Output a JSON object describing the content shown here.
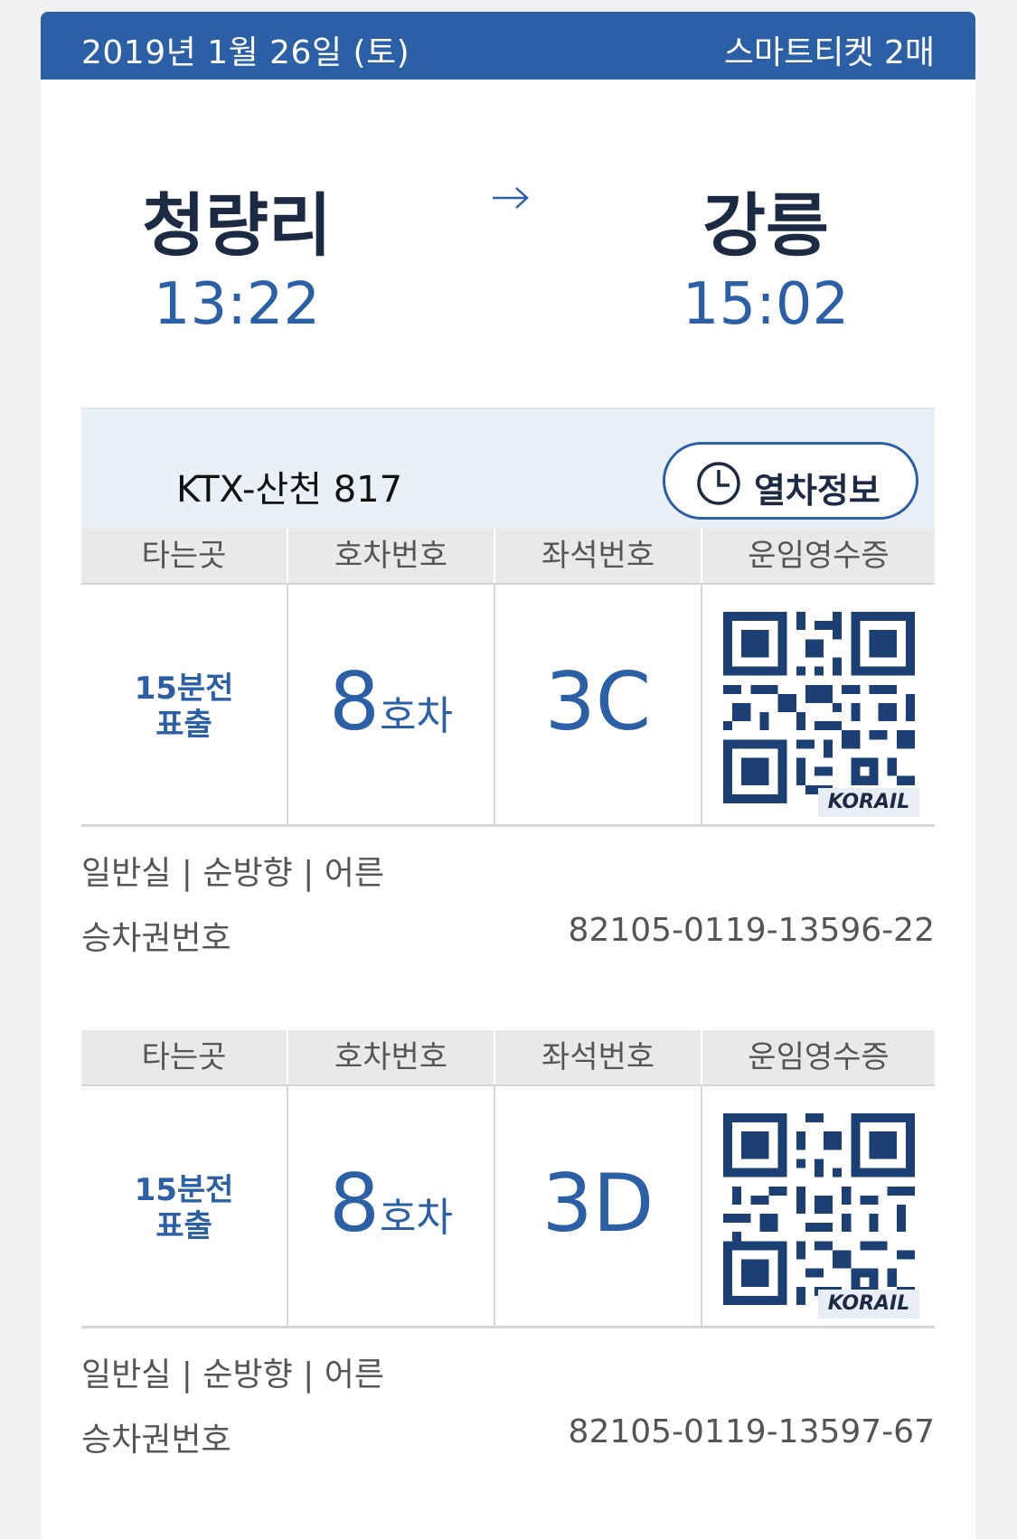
{
  "header": {
    "date": "2019년 1월 26일 (토)",
    "ticket_count": "스마트티켓 2매"
  },
  "route": {
    "departure_station": "청량리",
    "departure_time": "13:22",
    "arrival_station": "강릉",
    "arrival_time": "15:02"
  },
  "train": {
    "name": "KTX-산천 817",
    "info_button": "열차정보"
  },
  "ticket_headers": {
    "boarding": "타는곳",
    "car": "호차번호",
    "seat": "좌석번호",
    "receipt": "운임영수증"
  },
  "tickets": [
    {
      "boarding_line1": "15분전",
      "boarding_line2": "표출",
      "car_number": "8",
      "car_unit": "호차",
      "seat": "3C",
      "qr_logo": "KORAIL",
      "class_info": "일반실 | 순방향 | 어른",
      "ticket_number_label": "승차권번호",
      "ticket_number": "82105-0119-13596-22"
    },
    {
      "boarding_line1": "15분전",
      "boarding_line2": "표출",
      "car_number": "8",
      "car_unit": "호차",
      "seat": "3D",
      "qr_logo": "KORAIL",
      "class_info": "일반실 | 순방향 | 어른",
      "ticket_number_label": "승차권번호",
      "ticket_number": "82105-0119-13597-67"
    }
  ],
  "icons": {
    "arrow": "arrow-right-icon",
    "clock": "clock-icon",
    "qr": "qr-code-icon"
  },
  "colors": {
    "brand_blue": "#2b5fa6",
    "dark_text": "#1c2a44"
  }
}
